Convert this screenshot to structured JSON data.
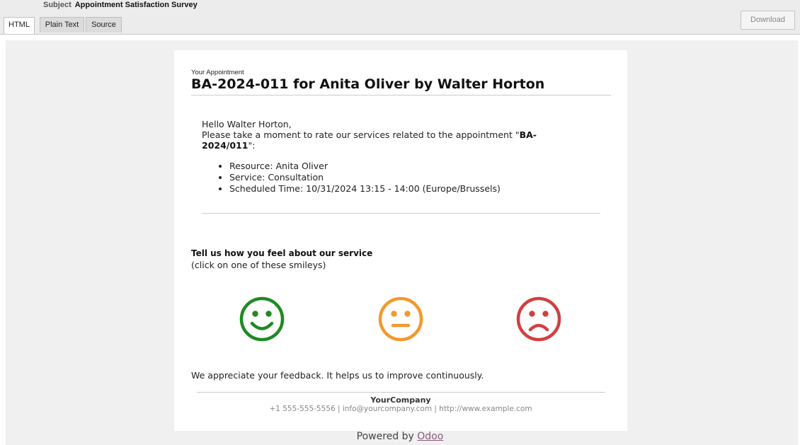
{
  "header": {
    "subject_label": "Subject",
    "subject_value": "Appointment Satisfaction Survey",
    "tabs": [
      {
        "label": "HTML",
        "active": true
      },
      {
        "label": "Plain Text",
        "active": false
      },
      {
        "label": "Source",
        "active": false
      }
    ],
    "download_label": "Download"
  },
  "email": {
    "eyebrow": "Your Appointment",
    "title": "BA-2024-011 for Anita Oliver by Walter Horton",
    "greeting": "Hello Walter Horton,",
    "body_prefix": "Please take a moment to rate our services related to the appointment \"",
    "appointment_ref": "BA-2024/011",
    "body_suffix": "\":",
    "details": [
      "Resource: Anita Oliver",
      "Service: Consultation",
      "Scheduled Time: 10/31/2024 13:15 - 14:00 (Europe/Brussels)"
    ],
    "rating_title": "Tell us how you feel about our service",
    "rating_subtitle": "(click on one of these smileys)",
    "smileys": [
      {
        "icon": "smiley-happy-icon",
        "color": "#1e8a22"
      },
      {
        "icon": "smiley-neutral-icon",
        "color": "#f2992e"
      },
      {
        "icon": "smiley-sad-icon",
        "color": "#d14040"
      }
    ],
    "thanks": "We appreciate your feedback. It helps us to improve continuously.",
    "company_name": "YourCompany",
    "company_contact": "+1 555-555-5556 | info@yourcompany.com | http://www.example.com"
  },
  "footer": {
    "powered_by": "Powered by ",
    "brand": "Odoo"
  },
  "colors": {
    "accent_link": "#875a7b",
    "happy": "#1e8a22",
    "neutral": "#f2992e",
    "sad": "#d14040"
  }
}
